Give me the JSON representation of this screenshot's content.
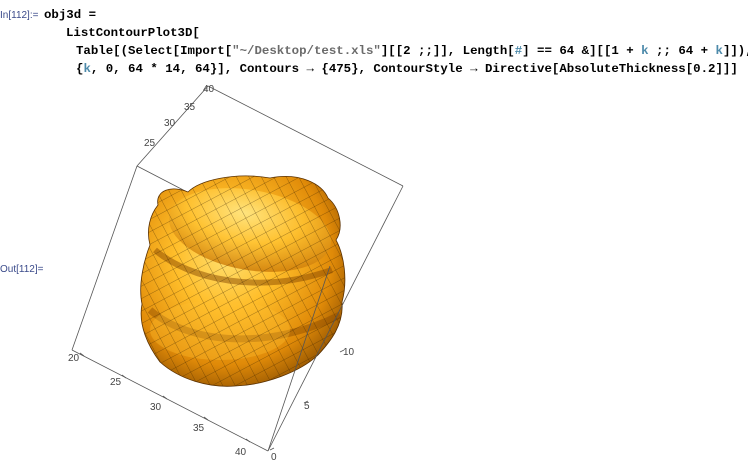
{
  "input_cell": {
    "label": "In[112]:=",
    "lines": [
      [
        {
          "t": "obj3d =",
          "c": "plain"
        }
      ],
      [
        {
          "t": "ListContourPlot3D[",
          "c": "plain"
        }
      ],
      [
        {
          "t": "Table[(Select[Import[",
          "c": "plain"
        },
        {
          "t": "\"~/Desktop/test.xls\"",
          "c": "str"
        },
        {
          "t": "][[2 ;;]], Length[",
          "c": "plain"
        },
        {
          "t": "#",
          "c": "var"
        },
        {
          "t": "] == 64 &][[1 + ",
          "c": "plain"
        },
        {
          "t": "k",
          "c": "var"
        },
        {
          "t": " ;; 64 + ",
          "c": "plain"
        },
        {
          "t": "k",
          "c": "var"
        },
        {
          "t": "]]),",
          "c": "plain"
        }
      ],
      [
        {
          "t": "{",
          "c": "plain"
        },
        {
          "t": "k",
          "c": "var"
        },
        {
          "t": ", 0, 64 * 14, 64}], Contours → {475}, ContourStyle → Directive[AbsoluteThickness[0.2]]]",
          "c": "plain"
        }
      ]
    ]
  },
  "output_cell": {
    "label": "Out[112]="
  },
  "plot": {
    "surface_color": "#f0a020",
    "frame_color": "#444444",
    "ticks_top": [
      "40",
      "35",
      "30",
      "25"
    ],
    "ticks_left": [
      "20",
      "25",
      "30",
      "35",
      "40"
    ],
    "ticks_right": [
      "10",
      "5",
      "0"
    ]
  }
}
